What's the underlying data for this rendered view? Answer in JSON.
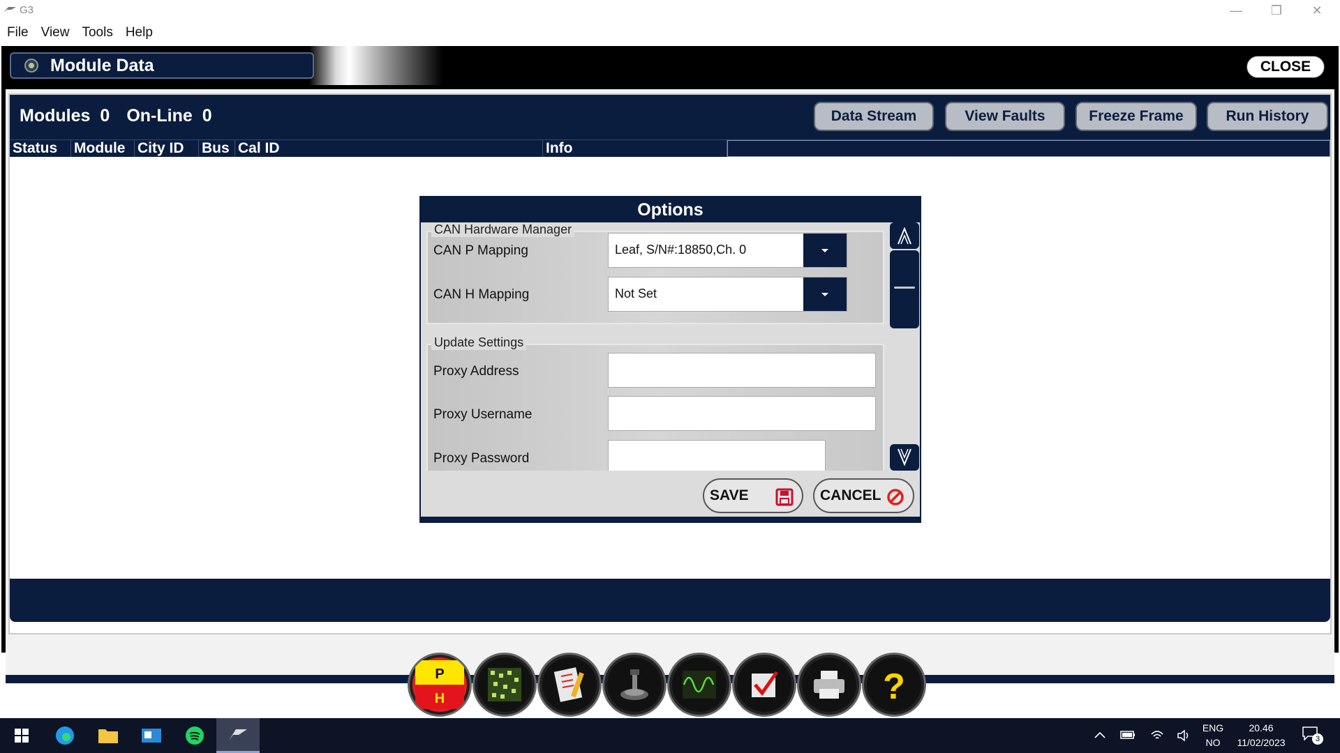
{
  "window": {
    "title": "G3"
  },
  "menu": [
    "File",
    "View",
    "Tools",
    "Help"
  ],
  "header": {
    "title": "Module Data",
    "close_label": "CLOSE"
  },
  "panel": {
    "modules_label": "Modules",
    "modules_count": "0",
    "online_label": "On-Line",
    "online_count": "0",
    "buttons": [
      "Data Stream",
      "View Faults",
      "Freeze Frame",
      "Run History"
    ],
    "columns": [
      "Status",
      "Module",
      "City ID",
      "Bus",
      "Cal ID",
      "Info"
    ]
  },
  "dialog": {
    "title": "Options",
    "can_group": {
      "label": "CAN Hardware Manager",
      "p_mapping_label": "CAN P Mapping",
      "p_mapping_value": "Leaf, S/N#:18850,Ch. 0",
      "h_mapping_label": "CAN H Mapping",
      "h_mapping_value": "Not Set"
    },
    "update_group": {
      "label": "Update Settings",
      "proxy_address_label": "Proxy Address",
      "proxy_address_value": "",
      "proxy_username_label": "Proxy Username",
      "proxy_username_value": "",
      "proxy_password_label": "Proxy Password",
      "proxy_password_value": ""
    },
    "save_label": "SAVE",
    "cancel_label": "CANCEL"
  },
  "toolbar": {
    "icons": [
      "park-hold-icon",
      "circuit-board-icon",
      "checklist-pencil-icon",
      "joystick-icon",
      "waveform-icon",
      "checkmark-icon",
      "printer-icon",
      "help-icon"
    ],
    "ph_top": "P",
    "ph_bottom": "H"
  },
  "taskbar": {
    "lang_top": "ENG",
    "lang_bottom": "NO",
    "time": "20.46",
    "date": "11/02/2023",
    "notification_count": "3"
  },
  "colors": {
    "navy": "#0b1d3f",
    "panel_bg": "#dcdcdc",
    "taskbar": "#0c1426"
  }
}
